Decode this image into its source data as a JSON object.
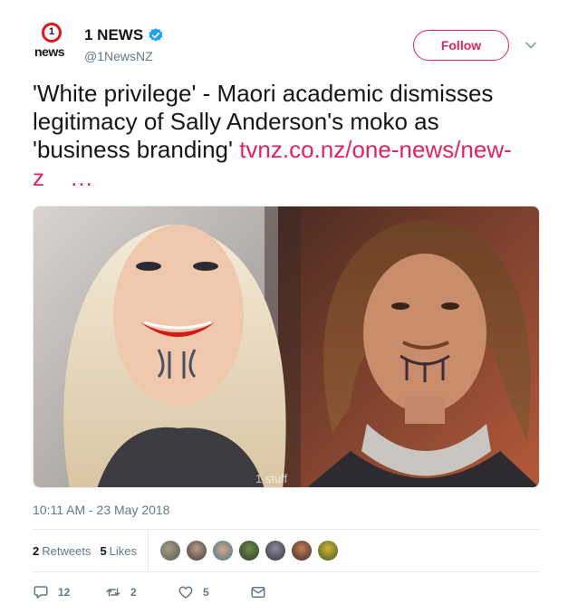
{
  "account": {
    "logo_number": "1",
    "logo_text": "news",
    "display_name": "1 NEWS",
    "handle": "@1NewsNZ",
    "verified": true
  },
  "header": {
    "follow_label": "Follow",
    "menu_icon": "chevron-down-icon"
  },
  "tweet": {
    "text": "'White privilege' - Maori academic dismisses legitimacy of Sally Anderson's moko as 'business branding' ",
    "link_text": "tvnz.co.nz/one-news/new-z",
    "ellipsis": "…",
    "timestamp": "10:11 AM - 23 May 2018"
  },
  "media": {
    "watermark": "1 stuff"
  },
  "stats": {
    "retweets_count": "2",
    "retweets_label": "Retweets",
    "likes_count": "5",
    "likes_label": "Likes"
  },
  "actions": {
    "reply_count": "12",
    "retweet_count": "2",
    "like_count": "5"
  },
  "colors": {
    "accent": "#e0245e",
    "text": "#14171a",
    "muted": "#657786",
    "border": "#e6ecf0",
    "verified": "#1da1f2"
  }
}
